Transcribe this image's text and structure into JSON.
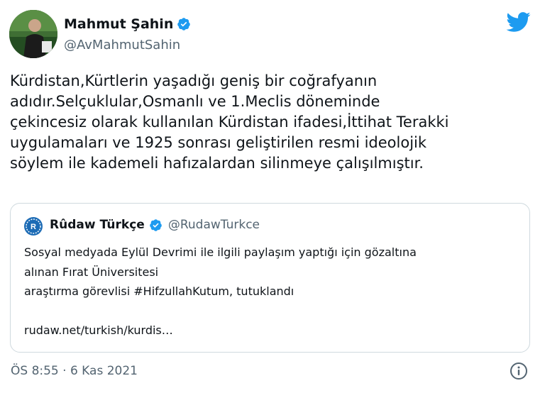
{
  "author": {
    "display_name": "Mahmut Şahin",
    "handle": "@AvMahmutSahin",
    "verified": true,
    "avatar": "profile-photo-avatar"
  },
  "brand": {
    "icon": "twitter-bird-icon",
    "color": "#1d9bf0"
  },
  "tweet": {
    "text": "Kürdistan,Kürtlerin yaşadığı geniş bir coğrafyanın\nadıdır.Selçuklular,Osmanlı ve 1.Meclis döneminde\nçekincesiz olarak kullanılan Kürdistan ifadesi,İttihat Terakki\nuygulamaları ve 1925 sonrası geliştirilen resmi ideolojik\nsöylem ile kademeli  hafızalardan silinmeye çalışılmıştır."
  },
  "quote": {
    "display_name": "Rûdaw Türkçe",
    "handle": "@RudawTurkce",
    "verified": true,
    "avatar": "rudaw-logo-avatar",
    "text": "Sosyal medyada Eylül Devrimi ile ilgili paylaşım yaptığı için gözaltına\nalınan Fırat Üniversitesi\naraştırma görevlisi #HifzullahKutum, tutuklandı\n\nrudaw.net/turkish/kurdis…"
  },
  "footer": {
    "timestamp": "ÖS 8:55 · 6 Kas 2021",
    "info_icon": "info-icon"
  },
  "colors": {
    "verified": "#1d9bf0",
    "text": "#0f1419",
    "secondary": "#536471",
    "border": "#cfd9de"
  }
}
